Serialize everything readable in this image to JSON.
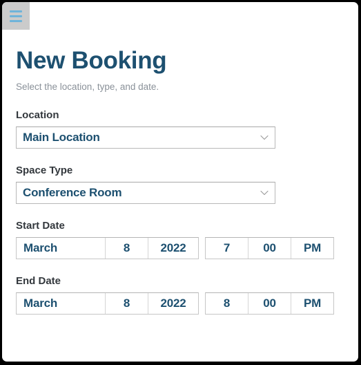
{
  "menu": {
    "button_name": "menu-toggle",
    "icon": "hamburger-menu-icon"
  },
  "header": {
    "title": "New Booking",
    "subtitle": "Select the location, type, and date.",
    "title_color": "#1d5070",
    "subtitle_color": "#8a9199"
  },
  "form": {
    "location": {
      "label": "Location",
      "value": "Main Location",
      "chevron_icon": "chevron-down-icon"
    },
    "space_type": {
      "label": "Space Type",
      "value": "Conference Room",
      "chevron_icon": "chevron-down-icon"
    },
    "start_date": {
      "label": "Start Date",
      "month": "March",
      "day": "8",
      "year": "2022",
      "hour": "7",
      "minute": "00",
      "meridiem": "PM"
    },
    "end_date": {
      "label": "End Date",
      "month": "March",
      "day": "8",
      "year": "2022",
      "hour": "8",
      "minute": "00",
      "meridiem": "PM"
    }
  },
  "colors": {
    "accent": "#1d5070",
    "menu_icon": "#6fb4da",
    "menu_bg": "#cbcbcb",
    "border": "#b8b8b8"
  }
}
